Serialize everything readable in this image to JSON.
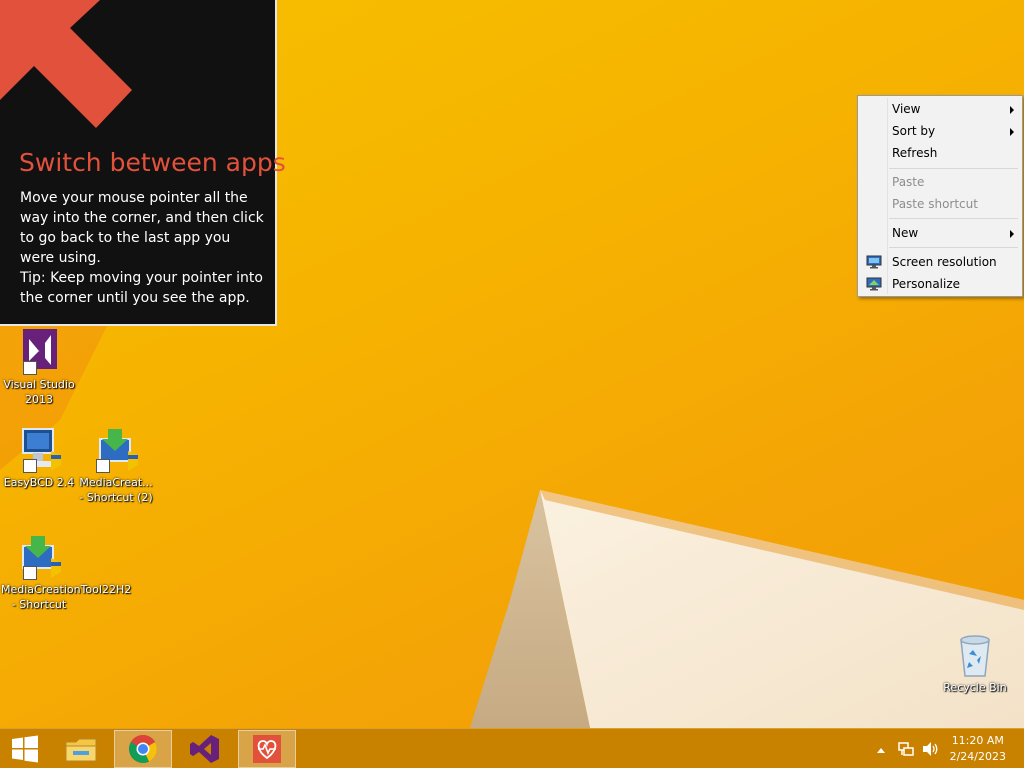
{
  "hint": {
    "title": "Switch between apps",
    "line1": "Move your mouse pointer all the way into the corner, and then click to go back to the last app you were using.",
    "line2": "Tip: Keep moving your pointer into the corner until you see the app."
  },
  "desktop_icons": [
    {
      "label": "Visual Studio 2013",
      "icon": "visual-studio-icon"
    },
    {
      "label": "EasyBCD 2.4",
      "icon": "easybcd-icon"
    },
    {
      "label": "MediaCreat... - Shortcut (2)",
      "icon": "media-creation-tool-icon"
    },
    {
      "label": "MediaCreationTool22H2 - Shortcut",
      "icon": "media-creation-tool-icon"
    },
    {
      "label": "Recycle Bin",
      "icon": "recycle-bin-icon"
    }
  ],
  "context_menu": {
    "view": "View",
    "sort_by": "Sort by",
    "refresh": "Refresh",
    "paste": "Paste",
    "paste_shortcut": "Paste shortcut",
    "new": "New",
    "screen_resolution": "Screen resolution",
    "personalize": "Personalize"
  },
  "taskbar": {
    "apps": [
      "start-button",
      "file-explorer-icon",
      "chrome-icon",
      "visual-studio-icon",
      "health-app-icon"
    ],
    "time": "11:20 AM",
    "date": "2/24/2023"
  },
  "colors": {
    "accent": "#e2513c",
    "wallpaper": "#f6b400",
    "taskbar": "#c98100"
  }
}
